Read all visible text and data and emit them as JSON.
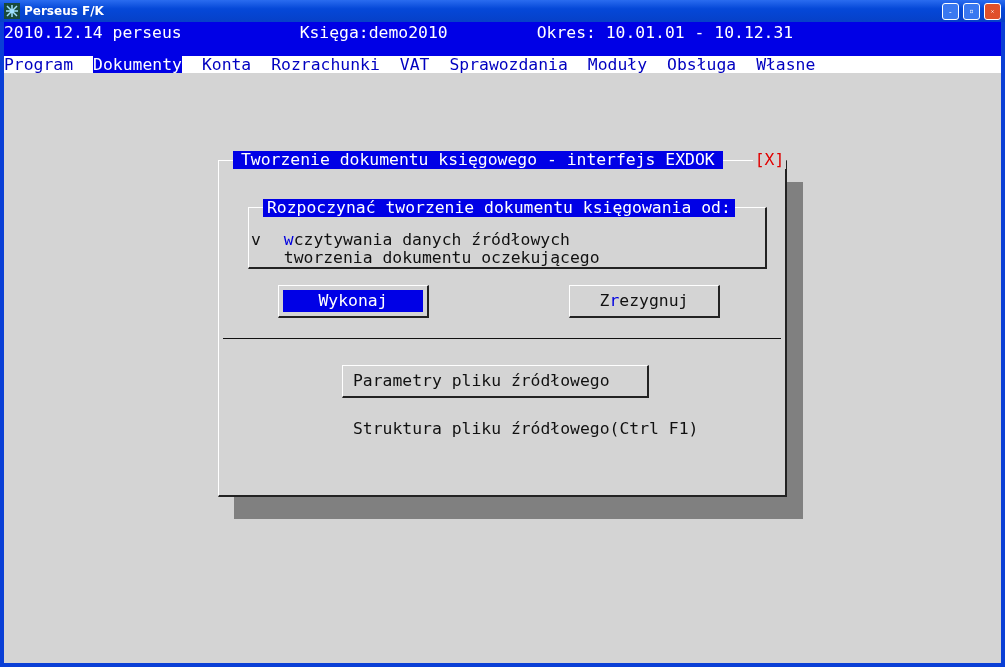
{
  "window": {
    "title": "Perseus F/K"
  },
  "status_line": {
    "date_user": "2010.12.14 perseus",
    "book": "Księga:demo2010",
    "period": "Okres: 10.01.01 - 10.12.31"
  },
  "menu": [
    {
      "label": "Program",
      "selected": false
    },
    {
      "label": "Dokumenty",
      "selected": true
    },
    {
      "label": "Konta",
      "selected": false
    },
    {
      "label": "Rozrachunki",
      "selected": false
    },
    {
      "label": "VAT",
      "selected": false
    },
    {
      "label": "Sprawozdania",
      "selected": false
    },
    {
      "label": "Moduły",
      "selected": false
    },
    {
      "label": "Obsługa",
      "selected": false
    },
    {
      "label": "Własne",
      "selected": false
    }
  ],
  "dialog": {
    "title": "Tworzenie dokumentu księgowego - interfejs EXDOK",
    "close": "[X]",
    "group": {
      "title": "Rozpoczynać tworzenie dokumentu księgowania od:",
      "mark": "v",
      "options": [
        {
          "parts": [
            {
              "text": "w",
              "hotkey": true
            },
            {
              "text": "czytywania danych źródłowych",
              "hotkey": false
            }
          ],
          "selected": true
        },
        {
          "parts": [
            {
              "text": "tworzenia dokumentu oczekującego",
              "hotkey": false
            }
          ],
          "selected": false
        }
      ]
    },
    "buttons": [
      {
        "parts": [
          {
            "text": "Wykonaj",
            "hotkey": false
          }
        ],
        "focused": true
      },
      {
        "parts": [
          {
            "text": "Z",
            "hotkey": false
          },
          {
            "text": "r",
            "hotkey": true
          },
          {
            "text": "ezygnuj",
            "hotkey": false
          }
        ],
        "focused": false
      }
    ],
    "params_button": {
      "label": "Parametry pliku źródłowego"
    },
    "structure_link": "Struktura pliku źródłowego(Ctrl F1)"
  }
}
